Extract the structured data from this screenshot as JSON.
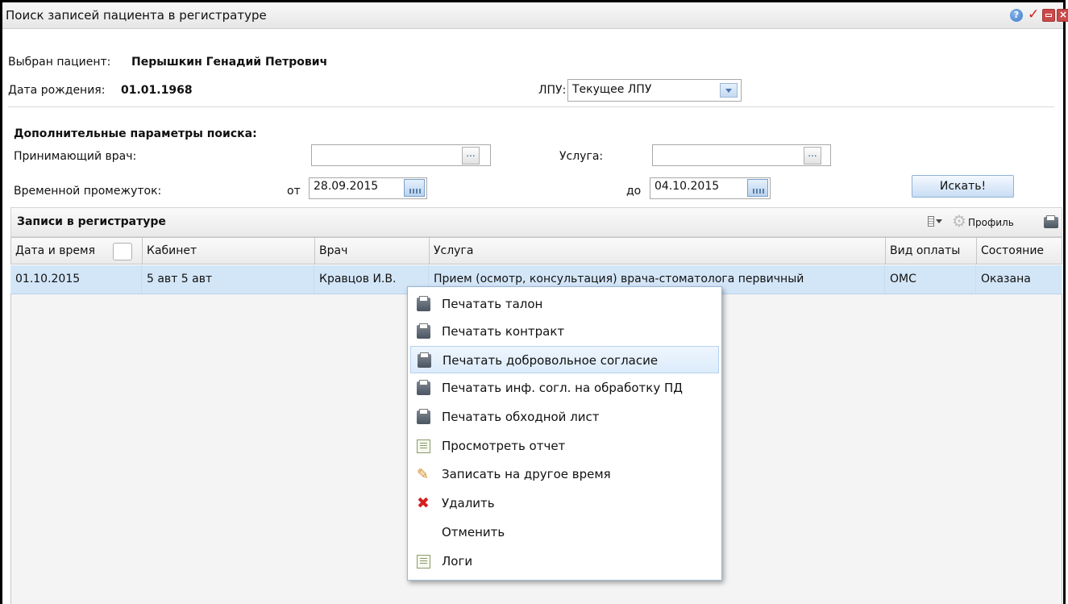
{
  "window": {
    "title": "Поиск записей пациента в регистратуре",
    "icons": [
      "help-icon",
      "checkmark-icon",
      "minimize-icon",
      "close-icon"
    ]
  },
  "patient": {
    "selected_label": "Выбран пациент:",
    "selected_value": "Перышкин Генадий Петрович",
    "dob_label": "Дата рождения:",
    "dob_value": "01.01.1968"
  },
  "lpu": {
    "label": "ЛПУ:",
    "value": "Текущее ЛПУ"
  },
  "extra": {
    "heading": "Дополнительные параметры поиска:",
    "doctor_label": "Принимающий врач:",
    "doctor_value": "",
    "service_label": "Услуга:",
    "service_value": "",
    "period_label": "Временной промежуток:",
    "from_label": "от",
    "from_value": "28.09.2015",
    "to_label": "до",
    "to_value": "04.10.2015",
    "dots": "...",
    "search_button": "Искать!"
  },
  "records": {
    "title": "Записи в регистратуре",
    "profile_label": "Профиль",
    "columns": [
      "Дата и время",
      "Кабинет",
      "Врач",
      "Услуга",
      "Вид оплаты",
      "Состояние"
    ],
    "rows": [
      {
        "date": "01.10.2015",
        "cabinet": "5 авт 5 авт",
        "doctor": "Кравцов И.В.",
        "service": "Прием (осмотр, консультация) врача-стоматолога первичный",
        "payment": "ОМС",
        "state": "Оказана"
      }
    ]
  },
  "context_menu": {
    "items": [
      {
        "label": "Печатать талон",
        "icon": "printer-icon"
      },
      {
        "label": "Печатать контракт",
        "icon": "printer-icon"
      },
      {
        "label": "Печатать добровольное согласие",
        "icon": "printer-icon",
        "active": true
      },
      {
        "label": "Печатать инф. согл. на обработку ПД",
        "icon": "printer-icon"
      },
      {
        "label": "Печатать обходной лист",
        "icon": "printer-icon"
      },
      {
        "label": "Просмотреть отчет",
        "icon": "report-icon"
      },
      {
        "label": "Записать на другое время",
        "icon": "pencil-icon"
      },
      {
        "label": "Удалить",
        "icon": "delete-icon"
      },
      {
        "label": "Отменить",
        "icon": ""
      },
      {
        "label": "Логи",
        "icon": "log-icon"
      }
    ]
  },
  "colors": {
    "selected_row": "#d3e6f8",
    "accent": "#2a5ca8",
    "delete": "#d42020"
  }
}
